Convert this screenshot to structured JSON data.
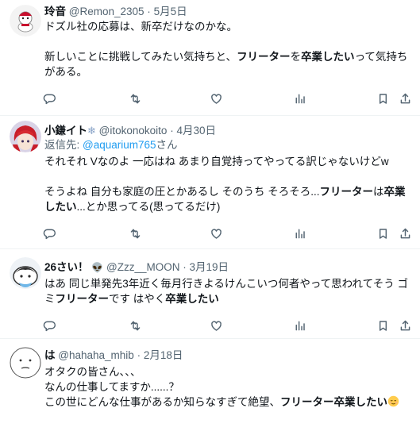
{
  "tweets": [
    {
      "name": "玲音",
      "handle": "@Remon_2305",
      "date": "5月5日",
      "lines": [
        [
          {
            "t": "ドズル社の応募は、新卒だけなのかな。"
          }
        ],
        [],
        [
          {
            "t": "新しいことに挑戦してみたい気持ちと、"
          },
          {
            "t": "フリーター",
            "b": true
          },
          {
            "t": "を"
          },
          {
            "t": "卒業したい",
            "b": true
          },
          {
            "t": "って気持ち"
          }
        ],
        [
          {
            "t": "がある。"
          }
        ]
      ]
    },
    {
      "name": "小鎌イト",
      "name_suffix": "❄",
      "handle": "@itokonokoito",
      "date": "4月30日",
      "reply_prefix": "返信先: ",
      "reply_mention": "@aquarium765",
      "reply_suffix": "さん",
      "lines": [
        [
          {
            "t": "それそれ Vなのよ 一応はね あまり自覚持ってやってる訳じゃないけどw"
          }
        ],
        [],
        [
          {
            "t": "そうよね 自分も家庭の圧とかあるし そのうち そろそろ..."
          },
          {
            "t": "フリーター",
            "b": true
          },
          {
            "t": "は"
          },
          {
            "t": "卒業",
            "b": true
          }
        ],
        [
          {
            "t": "したい",
            "b": true
          },
          {
            "t": "...とか思ってる(思ってるだけ)"
          }
        ]
      ]
    },
    {
      "name": "26さい！",
      "name_suffix": "👽",
      "handle": "@Zzz__MOON",
      "date": "3月19日",
      "lines": [
        [
          {
            "t": "はあ 同じ単発先3年近く毎月行きよるけんこいつ何者やって思われてそう ゴ"
          }
        ],
        [
          {
            "t": "ミ"
          },
          {
            "t": "フリーター",
            "b": true
          },
          {
            "t": "です はやく"
          },
          {
            "t": "卒業したい",
            "b": true
          }
        ]
      ]
    },
    {
      "name": "は",
      "handle": "@hahaha_mhib",
      "date": "2月18日",
      "lines": [
        [
          {
            "t": "オタクの皆さん、、、"
          }
        ],
        [
          {
            "t": "なんの仕事してますか......？"
          }
        ],
        [
          {
            "t": "この世にどんな仕事があるか知らなすぎて絶望、"
          },
          {
            "t": "フリーター卒業したい",
            "b": true
          },
          {
            "emoji": "relieved-face-emoji"
          }
        ]
      ]
    }
  ],
  "separator": "·",
  "colors": {
    "text": "#0f1419",
    "secondary": "#536471",
    "link": "#1d9bf0",
    "divider": "#eff3f4"
  },
  "action_icons": [
    "reply-icon",
    "retweet-icon",
    "like-icon",
    "views-icon",
    "bookmark-icon",
    "share-icon"
  ]
}
